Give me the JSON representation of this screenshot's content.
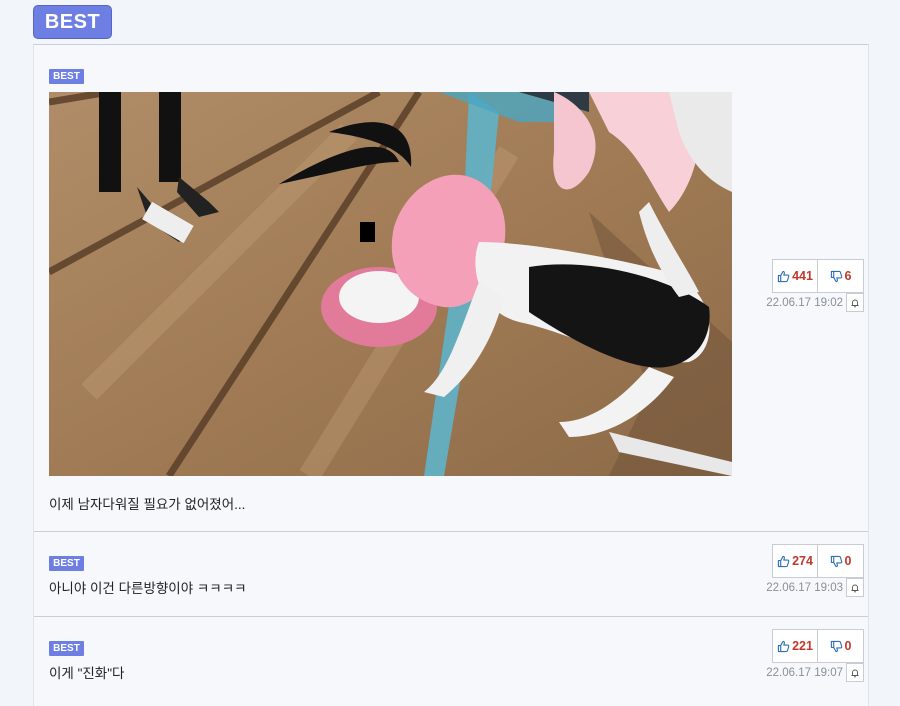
{
  "header": {
    "best_label": "BEST"
  },
  "posts": [
    {
      "badge": "BEST",
      "text": "이제 남자다워질 필요가 없어졌어...",
      "likes": "441",
      "dislikes": "6",
      "date": "22.06.17 19:02"
    },
    {
      "badge": "BEST",
      "text": "아니야 이건 다른방향이야 ㅋㅋㅋㅋ",
      "likes": "274",
      "dislikes": "0",
      "date": "22.06.17 19:03"
    },
    {
      "badge": "BEST",
      "text": "이게 \"진화\"다",
      "likes": "221",
      "dislikes": "0",
      "date": "22.06.17 19:07"
    }
  ],
  "icons": {
    "like": "thumbs-up-icon",
    "dislike": "thumbs-down-icon",
    "report": "bell-icon"
  },
  "colors": {
    "accent": "#6d7fe3",
    "vote_count": "#c0392b",
    "date": "#8a8f99"
  }
}
